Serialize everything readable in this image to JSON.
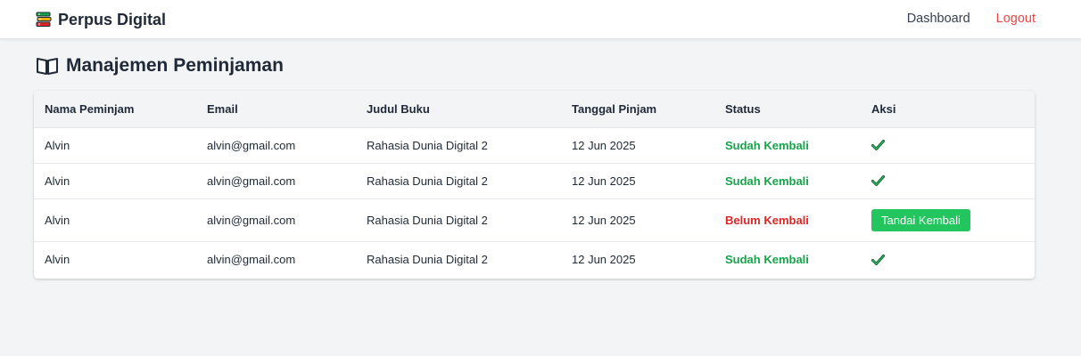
{
  "navbar": {
    "brand": "Perpus Digital",
    "brand_icon": "books-icon",
    "links": {
      "dashboard": "Dashboard",
      "logout": "Logout"
    }
  },
  "page": {
    "title": "Manajemen Peminjaman",
    "title_icon": "open-book-icon"
  },
  "table": {
    "headers": [
      "Nama Peminjam",
      "Email",
      "Judul Buku",
      "Tanggal Pinjam",
      "Status",
      "Aksi"
    ],
    "rows": [
      {
        "name": "Alvin",
        "email": "alvin@gmail.com",
        "book": "Rahasia Dunia Digital 2",
        "date": "12 Jun 2025",
        "status": "Sudah Kembali",
        "action_icon": "check-icon"
      },
      {
        "name": "Alvin",
        "email": "alvin@gmail.com",
        "book": "Rahasia Dunia Digital 2",
        "date": "12 Jun 2025",
        "status": "Sudah Kembali",
        "action_icon": "check-icon"
      },
      {
        "name": "Alvin",
        "email": "alvin@gmail.com",
        "book": "Rahasia Dunia Digital 2",
        "date": "12 Jun 2025",
        "status": "Belum Kembali",
        "action_label": "Tandai Kembali"
      },
      {
        "name": "Alvin",
        "email": "alvin@gmail.com",
        "book": "Rahasia Dunia Digital 2",
        "date": "12 Jun 2025",
        "status": "Sudah Kembali",
        "action_icon": "check-icon"
      }
    ]
  },
  "colors": {
    "returned": "#16a34a",
    "not_returned": "#dc2626",
    "action_button": "#22c55e",
    "logout": "#ef4444"
  }
}
